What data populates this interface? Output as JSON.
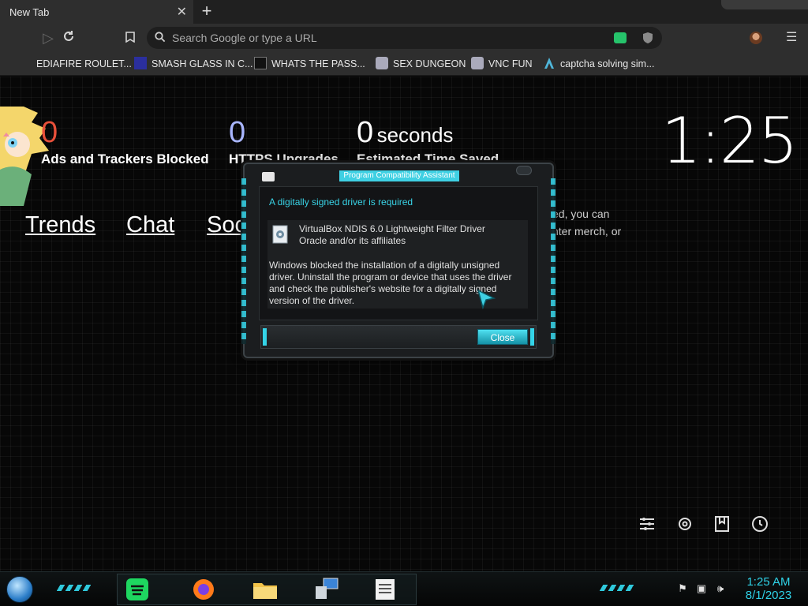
{
  "browser": {
    "tab": {
      "title": "New Tab"
    },
    "omnibox": {
      "placeholder": "Search Google or type a URL"
    },
    "bookmarks": [
      {
        "label": "EDIAFIRE ROULET...",
        "icon": "mediafire-icon"
      },
      {
        "label": "SMASH GLASS IN C...",
        "icon": "glass-icon"
      },
      {
        "label": "WHATS THE PASS...",
        "icon": "lock-icon"
      },
      {
        "label": "SEX DUNGEON",
        "icon": "dungeon-icon"
      },
      {
        "label": "VNC FUN",
        "icon": "vnc-icon"
      },
      {
        "label": "captcha solving sim...",
        "icon": "captcha-icon"
      }
    ]
  },
  "ntp": {
    "stats": [
      {
        "value": "0",
        "label": "Ads and Trackers Blocked",
        "color": "#e8503a"
      },
      {
        "value": "0",
        "label": "HTTPS Upgrades",
        "color": "#a9b6ff"
      },
      {
        "value": "0",
        "unit": "seconds",
        "label": "Estimated Time Saved",
        "color": "#ffffff"
      }
    ],
    "clock": "1:25",
    "links": [
      "Trends",
      "Chat",
      "Soc"
    ],
    "side_text": {
      "line1": "ed, you can",
      "link": "nter merch",
      "line2_suffix": ", or"
    }
  },
  "dialog": {
    "title": "Program Compatibility Assistant",
    "heading": "A digitally signed driver is required",
    "driver_name": "VirtualBox NDIS 6.0 Lightweight Filter Driver",
    "publisher": "Oracle and/or its affiliates",
    "message": "Windows blocked the installation of a digitally unsigned driver.  Uninstall the program or device that uses the driver and check the publisher's website for a digitally signed version of the driver.",
    "close_label": "Close"
  },
  "taskbar": {
    "time": "1:25 AM",
    "date": "8/1/2023",
    "apps": [
      "spotify-icon",
      "firefox-icon",
      "folder-icon",
      "network-icon",
      "notepad-icon"
    ],
    "accent": "#2fd3e8"
  }
}
